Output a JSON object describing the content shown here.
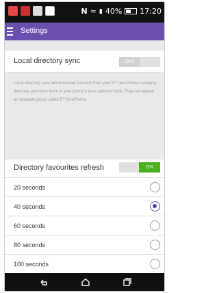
{
  "status_bar": {
    "signal_percent": "40%",
    "time": "17:20",
    "icons": [
      "sms-icon",
      "mail-icon",
      "voicemail-icon",
      "gallery-icon",
      "nfc-icon",
      "wifi-icon",
      "signal-icon",
      "battery-icon"
    ]
  },
  "app_bar": {
    "title": "Settings",
    "menu_icon": "hamburger-menu-icon"
  },
  "local_sync": {
    "label": "Local directory sync",
    "toggle_text": "OFF",
    "state": "off",
    "description": "Local directory sync will download contacts from your BT One Phone company directory and store them in your phone's local address book. They will appear as separate group called BT OnePhone."
  },
  "favourites_refresh": {
    "label": "Directory favourites refresh",
    "toggle_text": "ON",
    "state": "on",
    "options": [
      {
        "label": "20 seconds",
        "selected": false
      },
      {
        "label": "40 seconds",
        "selected": true
      },
      {
        "label": "60 seconds",
        "selected": false
      },
      {
        "label": "80 seconds",
        "selected": false
      },
      {
        "label": "100 seconds",
        "selected": false
      }
    ]
  },
  "nav_bar": {
    "icons": [
      "back-icon",
      "home-icon",
      "recents-icon"
    ]
  },
  "colors": {
    "accent": "#6b4fae",
    "toggle_on": "#4caf1e",
    "toggle_off": "#d2d2d2"
  }
}
